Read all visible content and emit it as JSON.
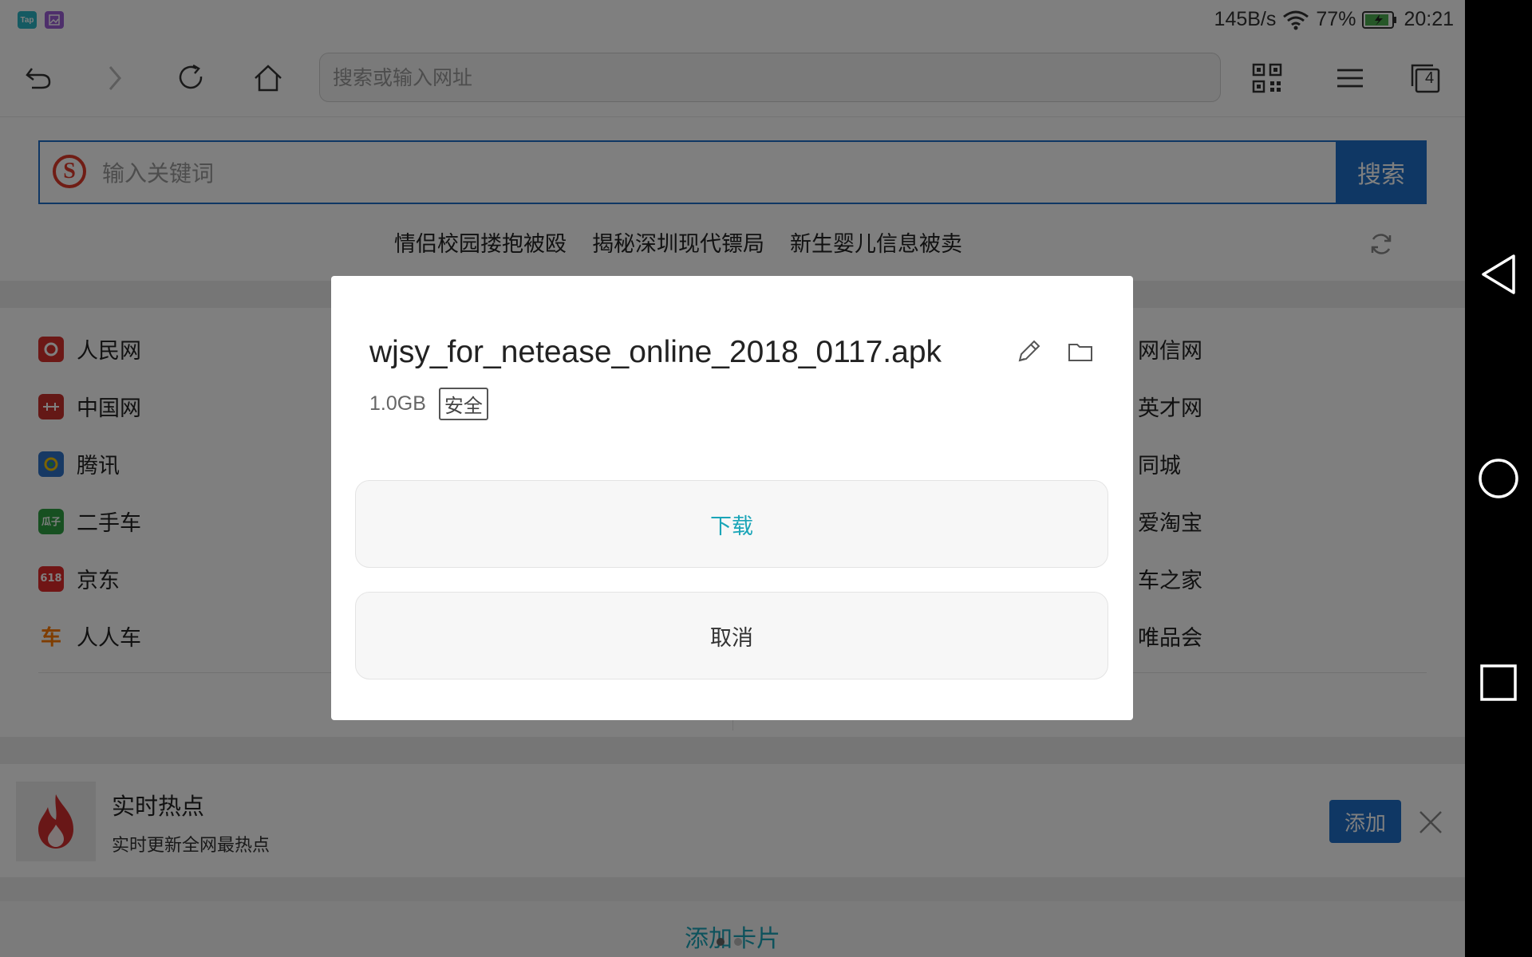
{
  "status_bar": {
    "app_icons": [
      "Tap",
      "gallery-icon"
    ],
    "net_speed": "145B/s",
    "battery_pct": "77%",
    "time": "20:21"
  },
  "toolbar": {
    "url_placeholder": "搜索或输入网址",
    "tab_count": "4"
  },
  "search": {
    "placeholder": "输入关键词",
    "button": "搜索",
    "hot_topics": [
      "情侣校园搂抱被殴",
      "揭秘深圳现代镖局",
      "新生婴儿信息被卖"
    ]
  },
  "sites_left": [
    {
      "label": "人民网",
      "icon": "people-daily-icon",
      "color": "#d9302c"
    },
    {
      "label": "中国网",
      "icon": "china-net-icon",
      "color": "#c9302c"
    },
    {
      "label": "腾讯",
      "icon": "tencent-icon",
      "color": "#2f73c8"
    },
    {
      "label": "二手车",
      "icon": "guazi-icon",
      "color": "#2ea043",
      "icon_text": "瓜子"
    },
    {
      "label": "京东",
      "icon": "jd-icon",
      "color": "#e02a2a",
      "icon_text": "618"
    },
    {
      "label": "人人车",
      "icon": "renrenche-icon",
      "color": "#ff7a00",
      "icon_text": "车"
    }
  ],
  "sites_right": [
    "网信网",
    "英才网",
    "同城",
    "爱淘宝",
    "车之家",
    "唯品会"
  ],
  "card": {
    "title": "实时热点",
    "subtitle": "实时更新全网最热点",
    "add_button": "添加"
  },
  "add_card": "添加卡片",
  "dialog": {
    "filename": "wjsy_for_netease_online_2018_0117.apk",
    "size": "1.0GB",
    "badge": "安全",
    "download": "下载",
    "cancel": "取消"
  },
  "colors": {
    "accent_blue": "#1e6fc8",
    "teal": "#1aa5b8",
    "overlay": "rgba(0,0,0,0.5)"
  }
}
